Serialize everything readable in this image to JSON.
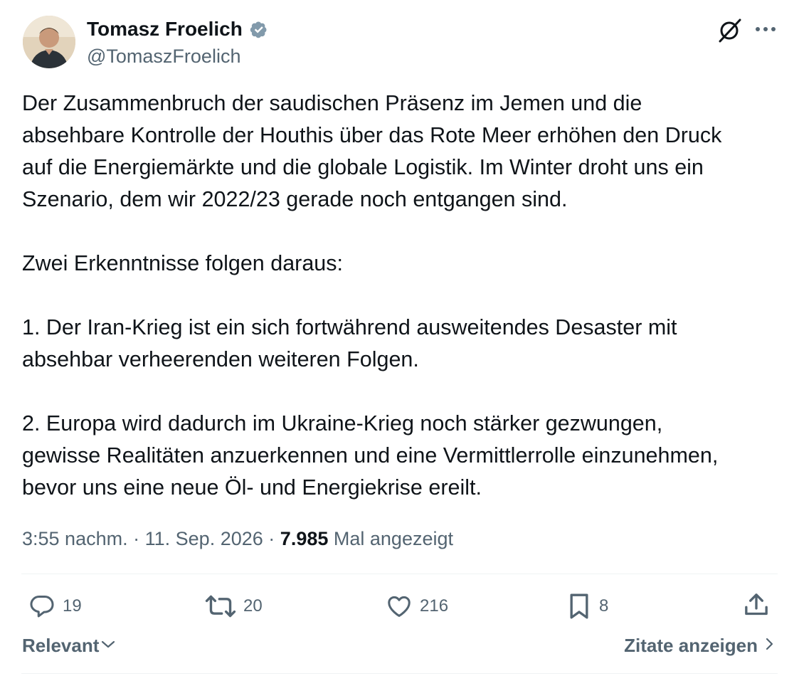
{
  "author": {
    "display_name": "Tomasz Froelich",
    "handle": "@TomaszFroelich",
    "verified": true,
    "verified_color": "#829aab"
  },
  "tweet": {
    "text": "Der Zusammenbruch der saudischen Präsenz im Jemen und die\nabsehbare Kontrolle der Houthis über das Rote Meer erhöhen den Druck\nauf die Energiemärkte und die globale Logistik. Im Winter droht uns ein\nSzenario, dem wir 2022/23 gerade noch entgangen sind.\n\nZwei Erkenntnisse folgen daraus:\n\n1. Der Iran-Krieg ist ein sich fortwährend ausweitendes Desaster mit\nabsehbar verheerenden weiteren Folgen.\n\n2. Europa wird dadurch im Ukraine-Krieg noch stärker gezwungen,\ngewisse Realitäten anzuerkennen und eine Vermittlerrolle einzunehmen,\nbevor uns eine neue Öl- und Energiekrise ereilt.",
    "time": "3:55 nachm.",
    "separator": "·",
    "date": "11. Sep. 2026",
    "views_count": "7.985",
    "views_label": "Mal angezeigt"
  },
  "actions": {
    "replies": "19",
    "reposts": "20",
    "likes": "216",
    "bookmarks": "8"
  },
  "footer": {
    "sort_label": "Relevant",
    "quotes_label": "Zitate anzeigen"
  },
  "icons": {
    "verified": "verified-badge-icon",
    "grok": "grok-icon",
    "more": "more-icon",
    "reply": "reply-icon",
    "repost": "repost-icon",
    "like": "heart-icon",
    "bookmark": "bookmark-icon",
    "share": "share-icon"
  },
  "colors": {
    "text_primary": "#0f1419",
    "text_secondary": "#536471",
    "divider": "#eff3f4"
  }
}
